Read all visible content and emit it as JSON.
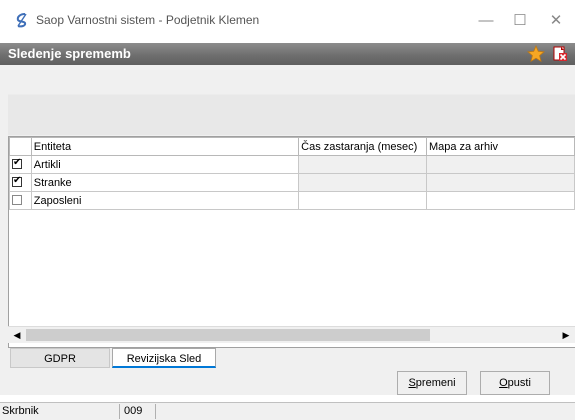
{
  "window": {
    "title": "Saop Varnostni sistem - Podjetnik Klemen",
    "minimize_glyph": "—",
    "maximize_glyph": "☐",
    "close_glyph": "✕"
  },
  "header": {
    "title": "Sledenje sprememb",
    "star_icon": "star-icon",
    "close_icon": "close-document-icon"
  },
  "grid": {
    "columns": [
      "",
      "Entiteta",
      "Čas zastaranja (mesec)",
      "Mapa za arhiv"
    ],
    "rows": [
      {
        "checked": true,
        "entity": "Artikli",
        "months": "",
        "archive": ""
      },
      {
        "checked": true,
        "entity": "Stranke",
        "months": "",
        "archive": ""
      },
      {
        "checked": false,
        "entity": "Zaposleni",
        "months": "",
        "archive": ""
      }
    ]
  },
  "scrollbar": {
    "left_glyph": "◀",
    "right_glyph": "▶"
  },
  "tabs": [
    {
      "label": "GDPR",
      "active": false
    },
    {
      "label": "Revizijska Sled",
      "active": true
    }
  ],
  "buttons": {
    "save": {
      "underlined": "S",
      "rest": "premeni"
    },
    "cancel": {
      "underlined": "O",
      "rest": "pusti"
    }
  },
  "status": {
    "user_label": "Skrbnik",
    "code": "009",
    "message": ""
  },
  "colors": {
    "accent": "#0078d7",
    "header_bg": "#6f6f6f",
    "star": "#f5a623",
    "close_red": "#d9262c"
  }
}
